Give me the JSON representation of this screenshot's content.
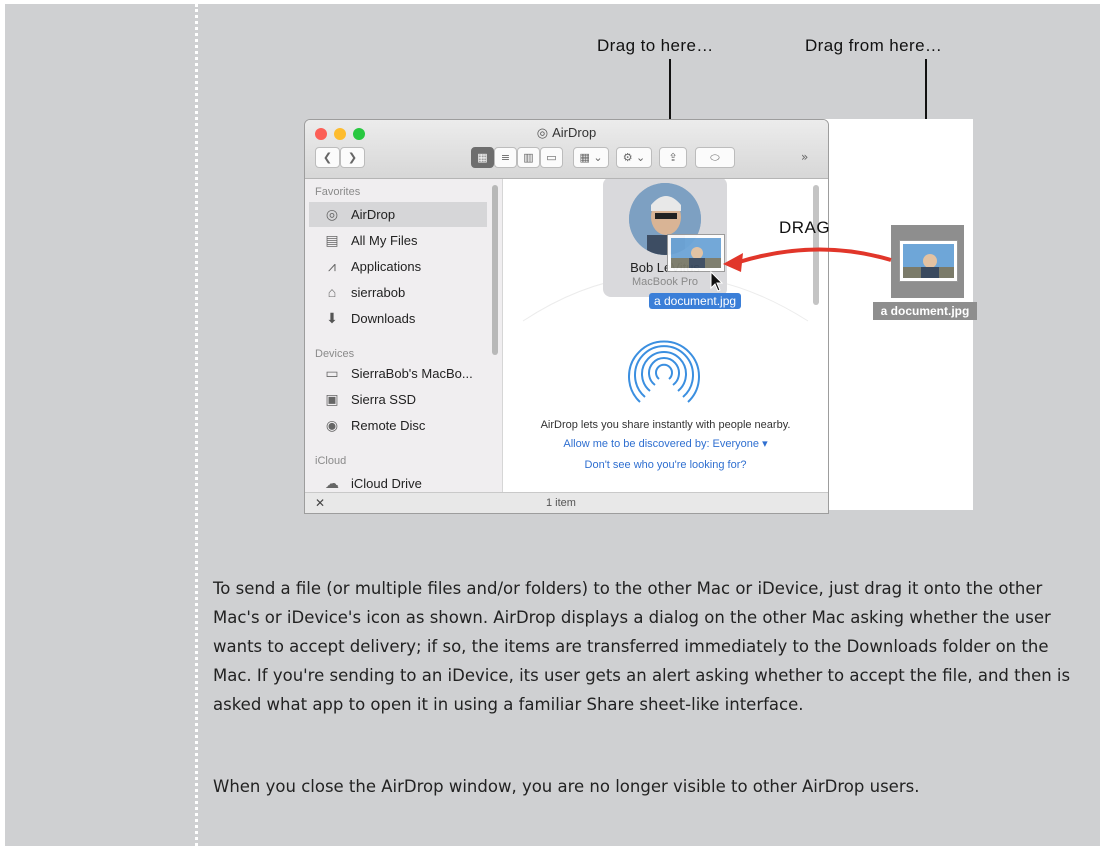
{
  "callouts": {
    "drag_to": "Drag to here…",
    "drag_from": "Drag from here…",
    "drag_arrow": "DRAG"
  },
  "window": {
    "title": "AirDrop",
    "status": "1 item",
    "sidebar": {
      "favorites_header": "Favorites",
      "favorites": [
        {
          "label": "AirDrop",
          "icon": "airdrop-icon"
        },
        {
          "label": "All My Files",
          "icon": "all-files-icon"
        },
        {
          "label": "Applications",
          "icon": "applications-icon"
        },
        {
          "label": "sierrabob",
          "icon": "home-icon"
        },
        {
          "label": "Downloads",
          "icon": "downloads-icon"
        }
      ],
      "devices_header": "Devices",
      "devices": [
        {
          "label": "SierraBob's MacBo...",
          "icon": "laptop-icon"
        },
        {
          "label": "Sierra SSD",
          "icon": "drive-icon"
        },
        {
          "label": "Remote Disc",
          "icon": "disc-icon"
        }
      ],
      "icloud_header": "iCloud",
      "icloud": [
        {
          "label": "iCloud Drive",
          "icon": "cloud-icon"
        }
      ]
    },
    "device": {
      "name": "Bob LeVitus",
      "model": "MacBook Pro"
    },
    "dragged_file_label": "a document.jpg",
    "airdrop_info": "AirDrop lets you share instantly with people nearby.",
    "discover_link": "Allow me to be discovered by: Everyone ▾",
    "looking_link": "Don't see who you're looking for?"
  },
  "desktop_file": {
    "label": "a document.jpg"
  },
  "body": {
    "paragraph1": "To send a file (or multiple files and/or folders) to the other Mac or iDevice, just drag it onto the other Mac's or iDevice's icon as shown. AirDrop displays a dialog on the other Mac asking whether the user wants to accept delivery; if so, the items are transferred immediately to the Downloads folder on the Mac. If you're sending to an iDevice, its user gets an alert asking whether to accept the file, and then is asked what app to open it in using a familiar Share sheet-like interface.",
    "paragraph2": "When you close the AirDrop window, you are no longer visible to other AirDrop users."
  },
  "colors": {
    "page_bg": "#cfd0d2",
    "accent_blue": "#3b7fd8",
    "drag_arrow": "#e1362a"
  }
}
